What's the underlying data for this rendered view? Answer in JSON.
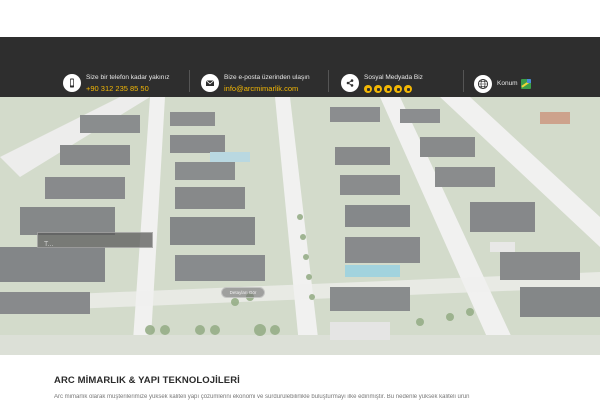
{
  "contact": {
    "phone": {
      "label": "Size bir telefon kadar yakınız",
      "value": "+90 312 235 85 50",
      "icon": "phone-icon"
    },
    "email": {
      "label": "Bize e-posta üzerinden ulaşın",
      "value": "info@arcmimarlik.com",
      "icon": "envelope-icon"
    },
    "social": {
      "label": "Sosyal Medyada Biz",
      "icon": "share-icon",
      "networks": [
        "facebook",
        "instagram",
        "linkedin",
        "youtube",
        "rss"
      ]
    },
    "location": {
      "label": "Konum",
      "icon": "globe-icon",
      "badge_icon": "google-maps-icon"
    }
  },
  "hero": {
    "search_placeholder": "T...",
    "button_label": "Detayları Gör"
  },
  "section": {
    "title": "ARC MİMARLIK & YAPI TEKNOLOJİLERİ",
    "intro": "Arc mimarlık olarak müşterilerimize yüksek kaliteli yapı çözümlerini ekonomi ve sürdürülebilirlikle buluşturmayı ilke edinmiştir. Bu nedenle yüksek kaliteli ürün"
  },
  "colors": {
    "accent": "#f2b705",
    "bar": "#2e2e2e"
  }
}
